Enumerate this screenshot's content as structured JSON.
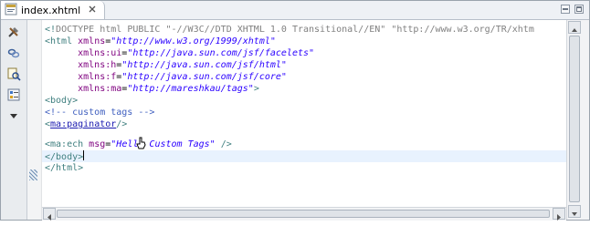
{
  "tab": {
    "title": "index.xhtml",
    "close_icon": "close-x-icon",
    "file_icon": "xhtml-file-icon"
  },
  "window_controls": {
    "minimize": "minimize-icon",
    "maximize": "maximize-icon"
  },
  "left_toolbar": [
    {
      "name": "tools-icon"
    },
    {
      "name": "link-icon"
    },
    {
      "name": "search-page-icon"
    },
    {
      "name": "properties-icon"
    },
    {
      "name": "dropdown-arrow-icon"
    }
  ],
  "code": {
    "line1": {
      "open": "<!",
      "doctype": "DOCTYPE html PUBLIC ",
      "v1": "\"-//W3C//DTD XHTML 1.0 Transitional//EN\"",
      "v2": " \"http://www.w3.org/TR/xhtm"
    },
    "line2": {
      "tag": "<html",
      "attr": " xmlns",
      "eq": "=",
      "val": "\"http://www.w3.org/1999/xhtml\""
    },
    "line3": {
      "indent": "      ",
      "attr": "xmlns:ui",
      "eq": "=",
      "val": "\"http://java.sun.com/jsf/facelets\""
    },
    "line4": {
      "indent": "      ",
      "attr": "xmlns:h",
      "eq": "=",
      "val": "\"http://java.sun.com/jsf/html\""
    },
    "line5": {
      "indent": "      ",
      "attr": "xmlns:f",
      "eq": "=",
      "val": "\"http://java.sun.com/jsf/core\""
    },
    "line6": {
      "indent": "      ",
      "attr": "xmlns:ma",
      "eq": "=",
      "val": "\"http://mareshkau/tags\"",
      "close": ">"
    },
    "line7": {
      "text": "<body>"
    },
    "line8": {
      "text": "<!-- custom tags -->"
    },
    "line9": {
      "lt": "<",
      "link": "ma:paginator",
      "end": "/>"
    },
    "line10": {
      "tag": "<ma:ech",
      "attr": " msg",
      "eq": "=",
      "val": "\"Helle Custom Tags\"",
      "end": " />"
    },
    "line11": {
      "text": "</body>"
    },
    "line12": {
      "text": "</html>"
    }
  }
}
